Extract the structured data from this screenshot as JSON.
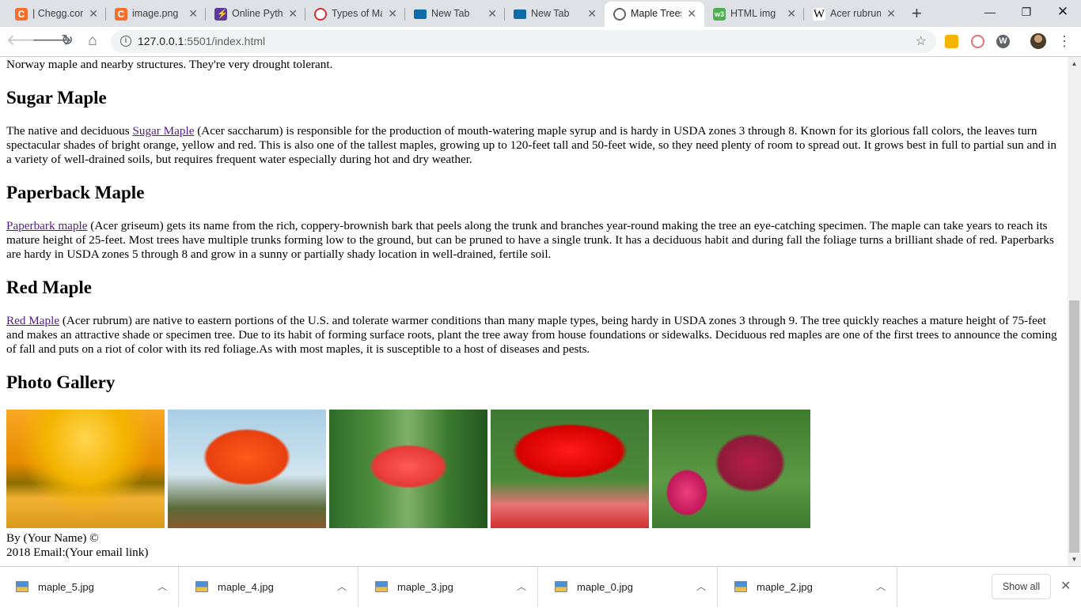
{
  "tabs": [
    {
      "label": "| Chegg.com",
      "favicon": "chegg-icon"
    },
    {
      "label": "image.png",
      "favicon": "chegg-icon"
    },
    {
      "label": "Online Python",
      "favicon": "bolt-icon"
    },
    {
      "label": "Types of Maple",
      "favicon": "quora-icon"
    },
    {
      "label": "New Tab",
      "favicon": "folder-icon"
    },
    {
      "label": "New Tab",
      "favicon": "folder-icon"
    },
    {
      "label": "Maple Trees",
      "favicon": "globe-icon"
    },
    {
      "label": "HTML img",
      "favicon": "w3schools-icon"
    },
    {
      "label": "Acer rubrum",
      "favicon": "wikipedia-icon"
    }
  ],
  "active_tab_index": 6,
  "address_bar": {
    "host": "127.0.0.1",
    "rest": ":5501/index.html"
  },
  "page": {
    "intro_tail": "Norway maple and nearby structures. They're very drought tolerant.",
    "sections": [
      {
        "heading": "Sugar Maple",
        "link": "Sugar Maple",
        "before": "The native and deciduous ",
        "after": " (Acer saccharum) is responsible for the production of mouth-watering maple syrup and is hardy in USDA zones 3 through 8. Known for its glorious fall colors, the leaves turn spectacular shades of bright orange, yellow and red. This is also one of the tallest maples, growing up to 120-feet tall and 50-feet wide, so they need plenty of room to spread out. It grows best in full to partial sun and in a variety of well-drained soils, but requires frequent water especially during hot and dry weather."
      },
      {
        "heading": "Paperback Maple",
        "link": "Paperbark maple",
        "before": "",
        "after": " (Acer griseum) gets its name from the rich, coppery-brownish bark that peels along the trunk and branches year-round making the tree an eye-catching specimen. The maple can take years to reach its mature height of 25-feet. Most trees have multiple trunks forming low to the ground, but can be pruned to have a single trunk. It has a deciduous habit and during fall the foliage turns a brilliant shade of red. Paperbarks are hardy in USDA zones 5 through 8 and grow in a sunny or partially shady location in well-drained, fertile soil."
      },
      {
        "heading": "Red Maple",
        "link": "Red Maple",
        "before": "",
        "after": " (Acer rubrum) are native to eastern portions of the U.S. and tolerate warmer conditions than many maple types, being hardy in USDA zones 3 through 9. The tree quickly reaches a mature height of 75-feet and makes an attractive shade or specimen tree. Due to its habit of forming surface roots, plant the tree away from house foundations or sidewalks. Deciduous red maples are one of the first trees to announce the coming of fall and puts on a riot of color with its red foliage.As with most maples, it is susceptible to a host of diseases and pests."
      }
    ],
    "gallery_heading": "Photo Gallery",
    "footer_line1": "By (Your Name) ©",
    "footer_line2": "2018 Email:(Your email link)"
  },
  "downloads": [
    "maple_5.jpg",
    "maple_4.jpg",
    "maple_3.jpg",
    "maple_0.jpg",
    "maple_2.jpg"
  ],
  "show_all_label": "Show all",
  "colors": {
    "link_visited": "#551a8b",
    "tab_strip": "#dee1e6"
  }
}
